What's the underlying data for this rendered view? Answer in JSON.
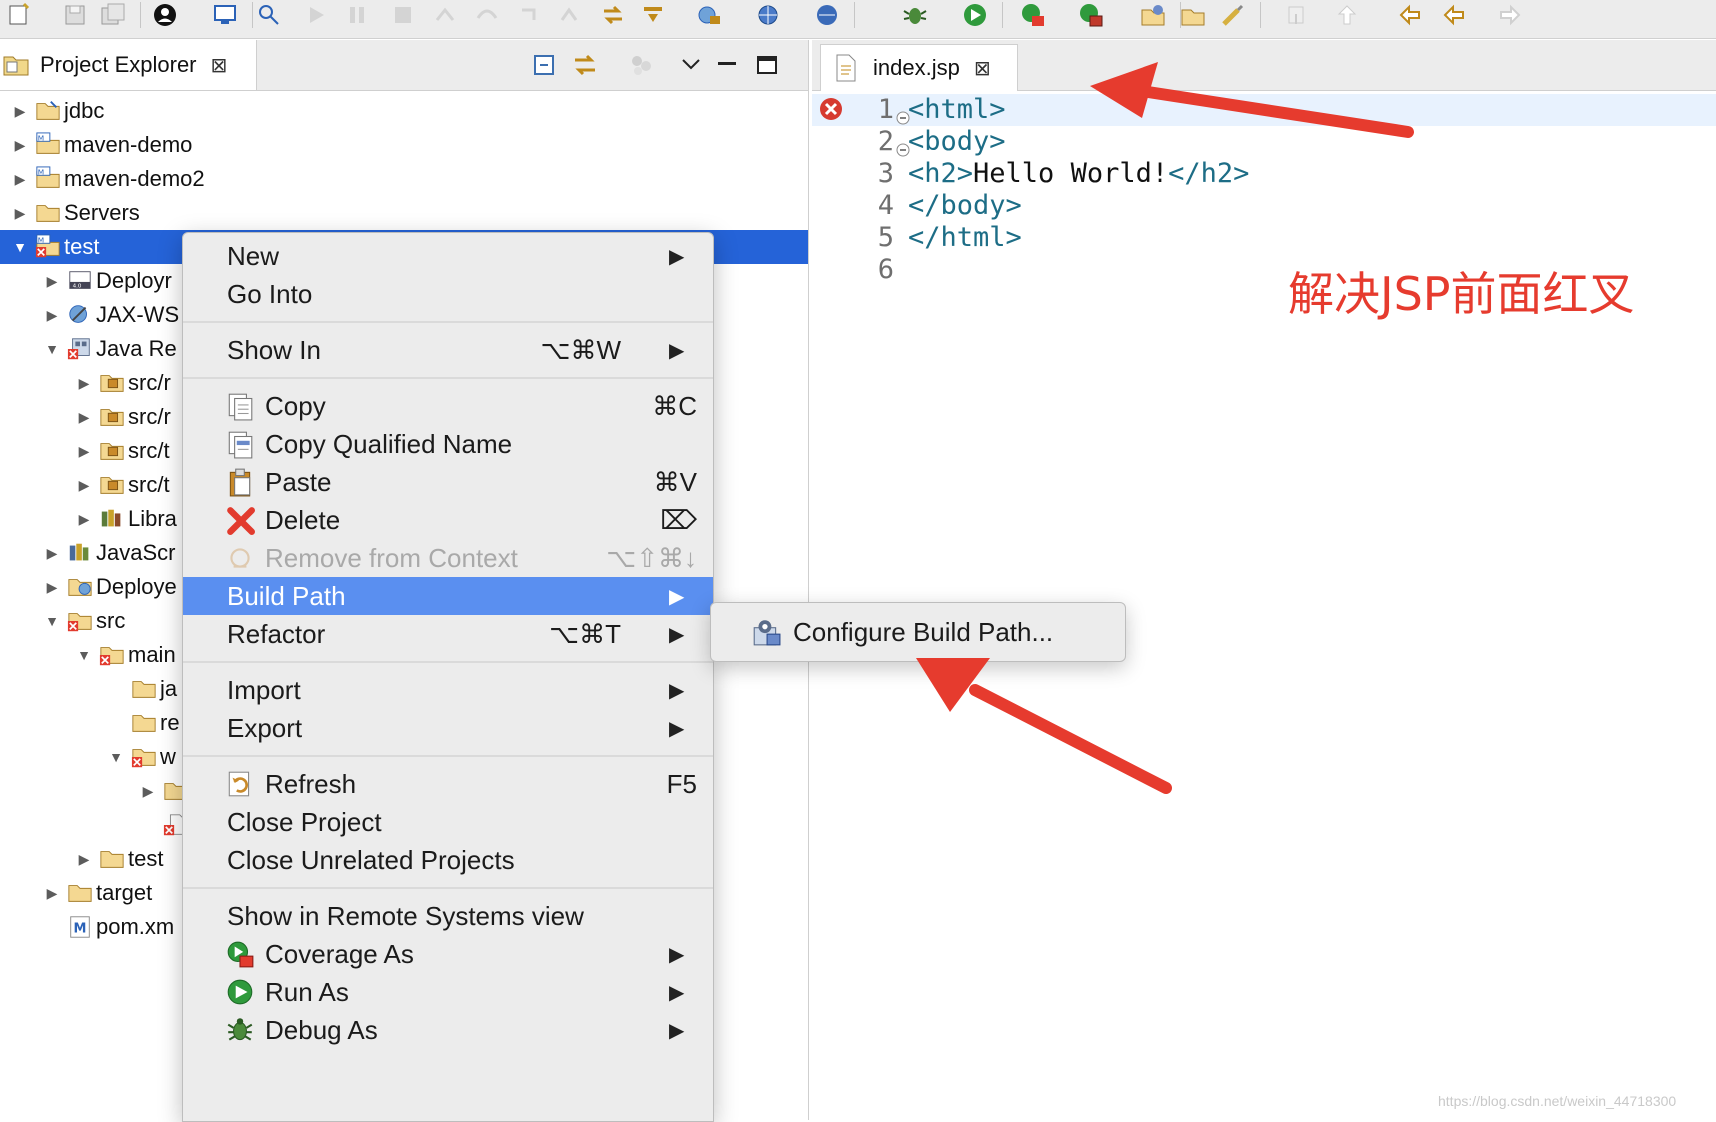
{
  "toolbar": {
    "icons": [
      "new-icon",
      "save-icon",
      "save-all-icon",
      "user-icon",
      "desktop-icon",
      "pin-icon",
      "run-ext-icon",
      "pause-icon",
      "stop-icon",
      "step-into-icon",
      "step-over-icon",
      "step-return-icon",
      "drop-frame-icon",
      "link-icon",
      "commit-icon",
      "server-icon",
      "globe-icon",
      "web-icon",
      "debug-icon",
      "run-icon",
      "coverage-icon",
      "ext-tools-icon",
      "open-type-icon",
      "open-task-icon",
      "search-icon",
      "next-annotation-icon",
      "prev-annotation-icon",
      "last-edit-icon",
      "back-icon",
      "forward-icon"
    ]
  },
  "project_explorer": {
    "tab_label": "Project Explorer",
    "close_glyph": "⊠",
    "tree": [
      {
        "label": "jdbc",
        "icon": "java-project-icon"
      },
      {
        "label": "maven-demo",
        "icon": "maven-project-icon"
      },
      {
        "label": "maven-demo2",
        "icon": "maven-project-icon"
      },
      {
        "label": "Servers",
        "icon": "folder-icon"
      },
      {
        "label": "test",
        "icon": "maven-project-error-icon"
      },
      {
        "label": "Deployr",
        "icon": "deployment-descriptor-icon"
      },
      {
        "label": "JAX-WS",
        "icon": "jaxws-icon"
      },
      {
        "label": "Java Re",
        "icon": "java-resources-error-icon"
      },
      {
        "label": "src/r",
        "icon": "package-folder-icon"
      },
      {
        "label": "src/r",
        "icon": "package-folder-icon"
      },
      {
        "label": "src/t",
        "icon": "package-folder-icon"
      },
      {
        "label": "src/t",
        "icon": "package-folder-icon"
      },
      {
        "label": "Libra",
        "icon": "libraries-icon"
      },
      {
        "label": "JavaScr",
        "icon": "javascript-resources-icon"
      },
      {
        "label": "Deploye",
        "icon": "deployed-resources-icon"
      },
      {
        "label": "src",
        "icon": "folder-error-icon"
      },
      {
        "label": "main",
        "icon": "folder-error-icon"
      },
      {
        "label": "ja",
        "icon": "folder-icon"
      },
      {
        "label": "re",
        "icon": "folder-icon"
      },
      {
        "label": "w",
        "icon": "folder-error-icon"
      },
      {
        "label": "",
        "icon": "folder-icon"
      },
      {
        "label": "",
        "icon": "file-error-icon"
      },
      {
        "label": "test",
        "icon": "folder-icon"
      },
      {
        "label": "target",
        "icon": "folder-icon"
      },
      {
        "label": "pom.xm",
        "icon": "maven-pom-icon"
      }
    ]
  },
  "editor": {
    "tab_label": "index.jsp",
    "close_glyph": "⊠",
    "lines": [
      {
        "num": "1",
        "segments": [
          {
            "t": "<html>",
            "c": "tag"
          }
        ],
        "error": true,
        "fold": true
      },
      {
        "num": "2",
        "segments": [
          {
            "t": "<body>",
            "c": "tag"
          }
        ],
        "error": false,
        "fold": true
      },
      {
        "num": "3",
        "segments": [
          {
            "t": "<h2>",
            "c": "tag"
          },
          {
            "t": "Hello World!",
            "c": "txt"
          },
          {
            "t": "</h2>",
            "c": "tag"
          }
        ],
        "error": false,
        "fold": false
      },
      {
        "num": "4",
        "segments": [
          {
            "t": "</body>",
            "c": "tag"
          }
        ],
        "error": false,
        "fold": false
      },
      {
        "num": "5",
        "segments": [
          {
            "t": "</html>",
            "c": "tag"
          }
        ],
        "error": false,
        "fold": false
      },
      {
        "num": "6",
        "segments": [],
        "error": false,
        "fold": false
      }
    ]
  },
  "annotation": {
    "text": "解决JSP前面红叉",
    "color": "#e63b2e"
  },
  "context_menu": {
    "groups": [
      [
        {
          "label": "New",
          "shortcut": "",
          "submenu": true,
          "icon": ""
        },
        {
          "label": "Go Into",
          "shortcut": "",
          "submenu": false,
          "icon": ""
        }
      ],
      [
        {
          "label": "Show In",
          "shortcut": "⌥⌘W",
          "submenu": true,
          "icon": ""
        }
      ],
      [
        {
          "label": "Copy",
          "shortcut": "⌘C",
          "submenu": false,
          "icon": "copy-icon"
        },
        {
          "label": "Copy Qualified Name",
          "shortcut": "",
          "submenu": false,
          "icon": "copy-qualified-icon"
        },
        {
          "label": "Paste",
          "shortcut": "⌘V",
          "submenu": false,
          "icon": "paste-icon"
        },
        {
          "label": "Delete",
          "shortcut": "⌦",
          "submenu": false,
          "icon": "delete-icon"
        },
        {
          "label": "Remove from Context",
          "shortcut": "⌥⇧⌘↓",
          "submenu": false,
          "icon": "remove-context-icon",
          "disabled": true
        },
        {
          "label": "Build Path",
          "shortcut": "",
          "submenu": true,
          "icon": "",
          "highlight": true
        },
        {
          "label": "Refactor",
          "shortcut": "⌥⌘T",
          "submenu": true,
          "icon": ""
        }
      ],
      [
        {
          "label": "Import",
          "shortcut": "",
          "submenu": true,
          "icon": ""
        },
        {
          "label": "Export",
          "shortcut": "",
          "submenu": true,
          "icon": ""
        }
      ],
      [
        {
          "label": "Refresh",
          "shortcut": "F5",
          "submenu": false,
          "icon": "refresh-icon"
        },
        {
          "label": "Close Project",
          "shortcut": "",
          "submenu": false,
          "icon": ""
        },
        {
          "label": "Close Unrelated Projects",
          "shortcut": "",
          "submenu": false,
          "icon": ""
        }
      ],
      [
        {
          "label": "Show in Remote Systems view",
          "shortcut": "",
          "submenu": false,
          "icon": ""
        },
        {
          "label": "Coverage As",
          "shortcut": "",
          "submenu": true,
          "icon": "coverage-icon"
        },
        {
          "label": "Run As",
          "shortcut": "",
          "submenu": true,
          "icon": "run-icon"
        },
        {
          "label": "Debug As",
          "shortcut": "",
          "submenu": true,
          "icon": "debug-icon"
        }
      ]
    ]
  },
  "build_path_submenu": {
    "items": [
      {
        "label": "Configure Build Path...",
        "icon": "configure-build-path-icon"
      }
    ]
  },
  "watermark": {
    "text": "https://blog.csdn.net/weixin_44718300"
  },
  "colors": {
    "selection": "#2563d8",
    "menu_highlight": "#5a8ff0",
    "arrow_red": "#e63b2e",
    "tag_color": "#1d6d86"
  }
}
